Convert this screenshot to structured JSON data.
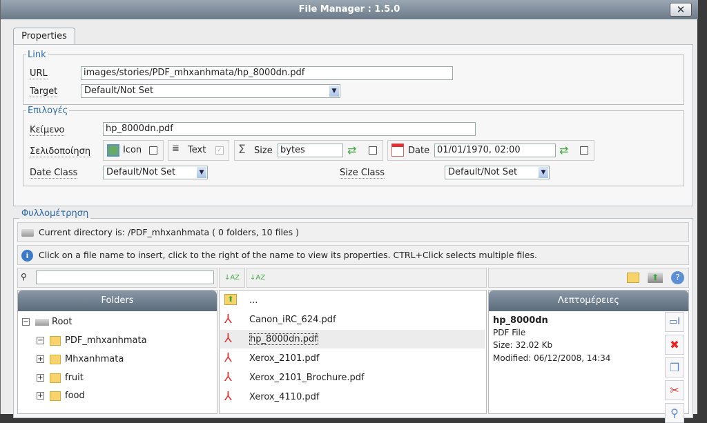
{
  "window": {
    "title": "File Manager : 1.5.0",
    "close": "✕"
  },
  "tab": "Properties",
  "link": {
    "legend": "Link",
    "url_label": "URL",
    "url_value": "images/stories/PDF_mhxanhmata/hp_8000dn.pdf",
    "target_label": "Target",
    "target_value": "Default/Not Set"
  },
  "options": {
    "legend": "Επιλογές",
    "text_label": "Κείμενο",
    "text_value": "hp_8000dn.pdf",
    "paging_label": "Σελιδοποίηση",
    "icon_label": "Icon",
    "icon_checked": false,
    "textopt_label": "Text",
    "textopt_checked": true,
    "size_label": "Size",
    "size_value": "bytes",
    "size_checked": false,
    "date_label": "Date",
    "date_value": "01/01/1970, 02:00",
    "date_checked": false,
    "date_class_label": "Date Class",
    "date_class_value": "Default/Not Set",
    "size_class_label": "Size Class",
    "size_class_value": "Default/Not Set"
  },
  "browser": {
    "legend": "Φυλλομέτρηση",
    "current_dir": "Current directory is: /PDF_mhxanhmata ( 0 folders, 10 files )",
    "info": "Click on a file name to insert, click to the right of the name to view its properties. CTRL+Click selects multiple files.",
    "search_value": ""
  },
  "folders": {
    "header": "Folders",
    "items": [
      {
        "label": "Root",
        "toggle": "−"
      },
      {
        "label": "PDF_mhxanhmata",
        "toggle": "−"
      },
      {
        "label": "Mhxanhmata",
        "toggle": "+"
      },
      {
        "label": "fruit",
        "toggle": "+"
      },
      {
        "label": "food",
        "toggle": "+"
      }
    ]
  },
  "files": {
    "up": "...",
    "items": [
      "Canon_iRC_624.pdf",
      "hp_8000dn.pdf",
      "Xerox_2101.pdf",
      "Xerox_2101_Brochure.pdf",
      "Xerox_4110.pdf"
    ],
    "selected": "hp_8000dn.pdf"
  },
  "details": {
    "header": "Λεπτομέρειες",
    "name": "hp_8000dn",
    "type": "PDF File",
    "size": "Size: 32.02 Kb",
    "modified": "Modified: 06/12/2008, 14:34"
  }
}
